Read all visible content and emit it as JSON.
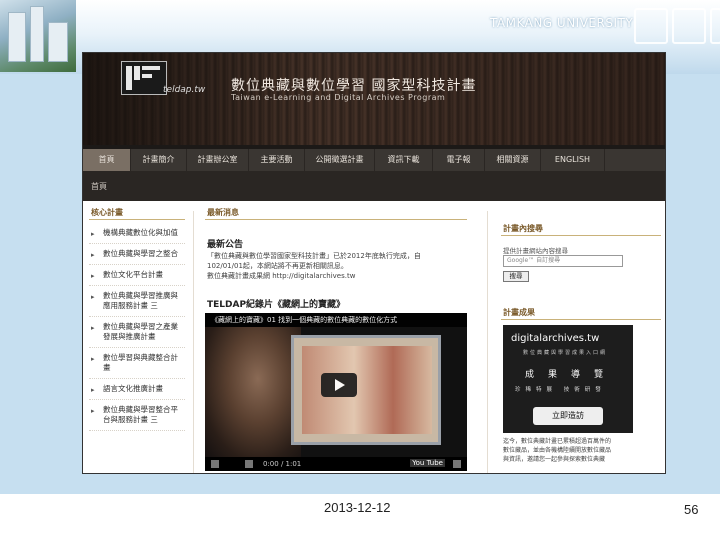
{
  "slide": {
    "university": "TAMKANG UNIVERSITY",
    "date": "2013-12-12",
    "page_number": "56"
  },
  "website": {
    "logo_text": "teldap.tw",
    "title": "數位典藏與數位學習 國家型科技計畫",
    "subtitle": "Taiwan e-Learning and Digital Archives Program",
    "nav": [
      "首頁",
      "計畫簡介",
      "計畫辦公室",
      "主要活動",
      "公開徵選計畫",
      "資訊下載",
      "電子報",
      "相關資源",
      "ENGLISH"
    ],
    "breadcrumb": "首頁",
    "left_column": {
      "title": "核心計畫",
      "items": [
        "機構典藏數位化與加值",
        "數位典藏與學習之整合",
        "數位文化平台計畫",
        "數位典藏與學習推廣與應用服務計畫 三",
        "數位典藏與學習之產業發展與推廣計畫",
        "數位學習與典藏整合計畫",
        "語言文化推廣計畫",
        "數位典藏與學習整合平台與服務計畫 三"
      ]
    },
    "news": {
      "section_title": "最新消息",
      "headline": "最新公告",
      "lines": [
        "「數位典藏與數位學習國家型科技計畫」已於2012年底執行完成，自",
        "102/01/01起，本網站將不再更新相關訊息。",
        "數位典藏計畫成果網 http://digitalarchives.tw"
      ]
    },
    "film": {
      "title": "TELDAP紀錄片《藏網上的寶藏》",
      "caption": "《藏網上的寶藏》01 找到一個典藏的數位典藏的數位化方式",
      "time": "0:00 / 1:01",
      "yt_label": "You Tube"
    },
    "search": {
      "title": "計畫內搜尋",
      "label": "提供計畫網站內容搜尋",
      "placeholder": "Google™ 自訂搜尋",
      "button": "搜尋"
    },
    "results": {
      "title": "計畫成果",
      "card_logo": "digitalarchives.tw",
      "card_sub": "數位典藏與學習成果入口網",
      "card_big": "成果導覽",
      "card_cats": "珍稀特展 技術研發",
      "card_button": "立即造訪",
      "lines": [
        "迄今，數位典藏計畫已累積超過百萬件的",
        "數位藏品，並由各機構陸續開放數位藏品",
        "與資訊，邀請您一起參與探索數位典藏"
      ]
    }
  }
}
